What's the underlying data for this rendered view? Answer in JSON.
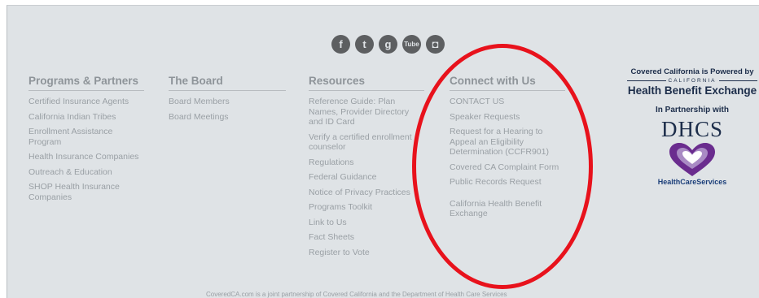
{
  "social": {
    "facebook": "f",
    "twitter": "t",
    "googleplus": "g",
    "youtube": "Tube",
    "instagram": "◘"
  },
  "columns": {
    "programs": {
      "heading": "Programs & Partners",
      "items": [
        "Certified Insurance Agents",
        "California Indian Tribes",
        "Enrollment Assistance Program",
        "Health Insurance Companies",
        "Outreach & Education",
        "SHOP Health Insurance Companies"
      ]
    },
    "board": {
      "heading": "The Board",
      "items": [
        "Board Members",
        "Board Meetings"
      ]
    },
    "resources": {
      "heading": "Resources",
      "items": [
        "Reference Guide: Plan Names, Provider Directory and ID Card",
        "Verify a certified enrollment counselor",
        "Regulations",
        "Federal Guidance",
        "Notice of Privacy Practices",
        "Programs Toolkit",
        "Link to Us",
        "Fact Sheets",
        "Register to Vote"
      ]
    },
    "connect": {
      "heading": "Connect with Us",
      "items": [
        "CONTACT US",
        "Speaker Requests",
        "Request for a Hearing to Appeal an Eligibility Determination (CCFR901)",
        "Covered CA Complaint Form",
        "Public Records Request",
        "California Health Benefit Exchange"
      ]
    }
  },
  "powered": {
    "line": "Covered California is Powered by",
    "california": "CALIFORNIA",
    "hbe": "Health Benefit Exchange",
    "partner": "In Partnership with",
    "dhcs": "DHCS",
    "hcs": "HealthCareServices"
  },
  "footer": {
    "note": "CoveredCA.com is a joint partnership of Covered California and the Department of Health Care Services"
  },
  "colors": {
    "background": "#dfe3e6",
    "link": "#9aa0a5",
    "heading": "#8e9499",
    "annotation": "#e8121c",
    "brand_navy": "#1c2d4a",
    "heart_purple": "#6a2c8e"
  }
}
